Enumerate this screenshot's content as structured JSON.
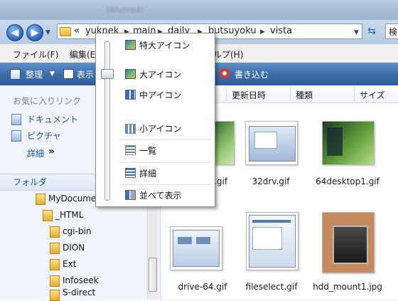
{
  "titlebar": {
    "blurred_text": "(blurred)"
  },
  "address": {
    "overflow": "«",
    "crumbs": [
      "yuknek",
      "main",
      "daily",
      "butsuyoku",
      "vista"
    ],
    "search_placeholder": "検"
  },
  "menu": {
    "items": [
      "ファイル(F)",
      "編集(E",
      "ルプ(H)"
    ]
  },
  "toolbar": {
    "organize": "整理",
    "view": "表示",
    "burn": "書き込む"
  },
  "favorites": {
    "header": "お気に入りリンク",
    "links": [
      "ドキュメント",
      "ピクチャ"
    ],
    "more": "詳細",
    "more_chevron": "»"
  },
  "folders": {
    "header": "フォルダ",
    "items": [
      "MyDocume",
      "_HTML",
      "cgi-bin",
      "DION",
      "Ext",
      "Infoseek",
      "S-direct"
    ]
  },
  "columns": {
    "modified": "更新日時",
    "type": "種類",
    "size": "サイズ"
  },
  "files": [
    {
      "name": "rv.gif"
    },
    {
      "name": "32drv.gif"
    },
    {
      "name": "64desktop1.gif"
    },
    {
      "name": "drive-64.gif"
    },
    {
      "name": "fileselect.gif"
    },
    {
      "name": "hdd_mount1.jpg"
    }
  ],
  "view_menu": {
    "items": [
      "特大アイコン",
      "大アイコン",
      "中アイコン",
      "小アイコン",
      "一覧",
      "詳細",
      "並べて表示"
    ],
    "slider_level": "大アイコン"
  },
  "colors": {
    "toolbar": "#3e6eaa",
    "link": "#1b4fa0",
    "accent": "#2d6fc6"
  }
}
